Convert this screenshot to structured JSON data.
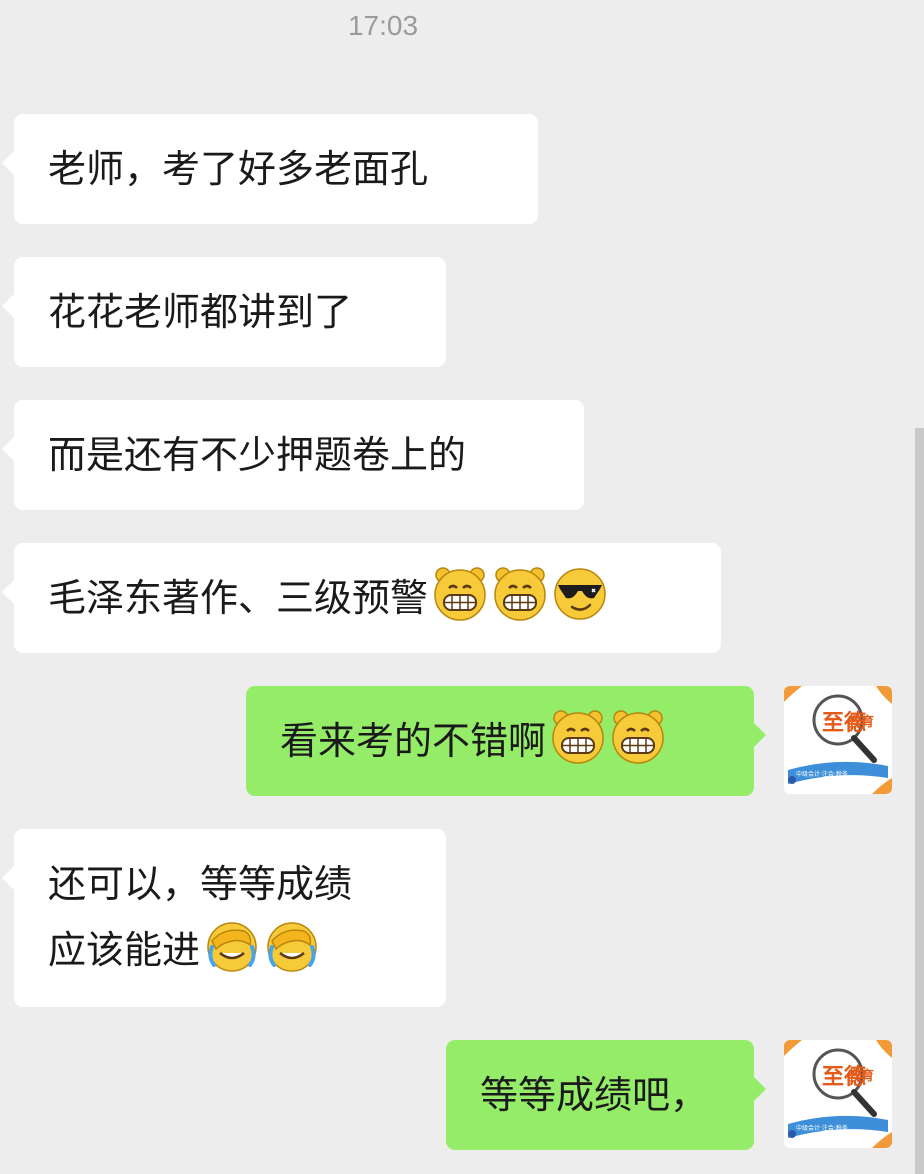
{
  "timestamp": "17:03",
  "messages": [
    {
      "side": "in",
      "text": "老师，考了好多老面孔",
      "emojis": []
    },
    {
      "side": "in",
      "text": "花花老师都讲到了",
      "emojis": []
    },
    {
      "side": "in",
      "text": "而是还有不少押题卷上的",
      "emojis": []
    },
    {
      "side": "in",
      "text": "毛泽东著作、三级预警",
      "emojis": [
        "grin-icon",
        "grin-icon",
        "sunglasses-icon"
      ]
    },
    {
      "side": "out",
      "text": "看来考的不错啊",
      "emojis": [
        "grin-icon",
        "grin-icon"
      ]
    },
    {
      "side": "in",
      "line1": "还可以，等等成绩",
      "line2": "应该能进",
      "emojis": [
        "facepalm-icon",
        "facepalm-icon"
      ]
    },
    {
      "side": "out",
      "text": "等等成绩吧，",
      "emojis": []
    }
  ],
  "avatar": {
    "logo_text_1": "至德",
    "logo_text_2": "教育",
    "caption": "中级会计·注会·税务"
  },
  "colors": {
    "background": "#EDEDED",
    "incoming_bubble": "#FFFFFF",
    "outgoing_bubble": "#95EC69",
    "text": "#1A1A1A",
    "timestamp": "#9B9B9B"
  }
}
